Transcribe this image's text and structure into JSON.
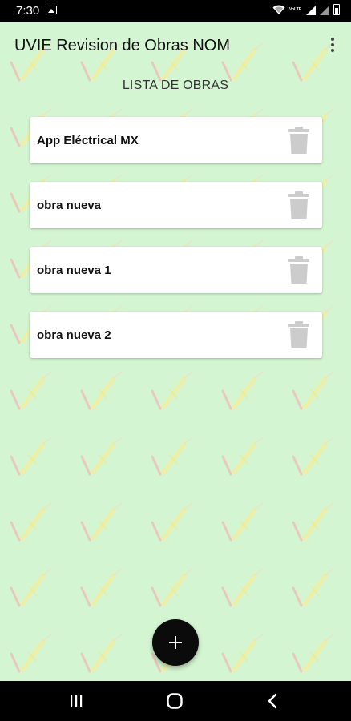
{
  "status_bar": {
    "time": "7:30",
    "right_text": "VoLTE"
  },
  "app_bar": {
    "title": "UVIE Revision de Obras NOM",
    "menu_icon": "overflow-menu-icon"
  },
  "section_title": "LISTA DE OBRAS",
  "obras": [
    {
      "label": "App Eléctrical MX"
    },
    {
      "label": "obra nueva"
    },
    {
      "label": "obra nueva 1"
    },
    {
      "label": "obra nueva 2"
    }
  ],
  "icons": {
    "delete": "trash-icon",
    "add": "plus-icon",
    "nav_recents": "recents-icon",
    "nav_home": "home-icon",
    "nav_back": "back-icon"
  },
  "colors": {
    "background": "#d4f5d2",
    "card": "#ffffff",
    "fab": "#0b0b0b",
    "trash": "#cccccc"
  }
}
